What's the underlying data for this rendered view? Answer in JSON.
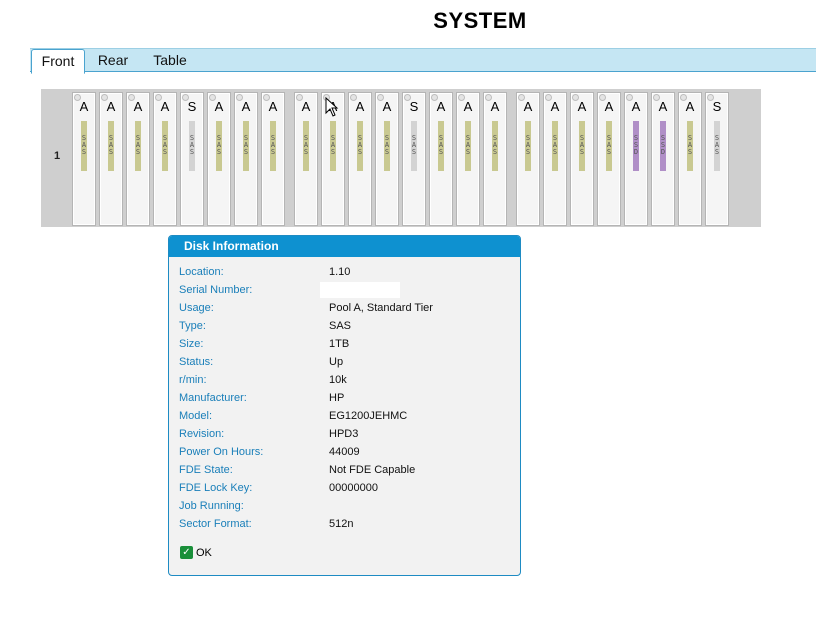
{
  "page": {
    "title": "SYSTEM"
  },
  "tabs": [
    {
      "label": "Front",
      "active": true
    },
    {
      "label": "Rear",
      "active": false
    },
    {
      "label": "Table",
      "active": false
    }
  ],
  "enclosure": {
    "row_label": "1",
    "disks": [
      {
        "letter": "A",
        "type": "SAS",
        "color": "#c9c991"
      },
      {
        "letter": "A",
        "type": "SAS",
        "color": "#c9c991"
      },
      {
        "letter": "A",
        "type": "SAS",
        "color": "#c9c991"
      },
      {
        "letter": "A",
        "type": "SAS",
        "color": "#c9c991"
      },
      {
        "letter": "S",
        "type": "SAS",
        "color": "#d3d3d3"
      },
      {
        "letter": "A",
        "type": "SAS",
        "color": "#c9c991"
      },
      {
        "letter": "A",
        "type": "SAS",
        "color": "#c9c991"
      },
      {
        "letter": "A",
        "type": "SAS",
        "color": "#c9c991"
      },
      {
        "letter": "A",
        "type": "SAS",
        "color": "#c9c991"
      },
      {
        "letter": "A",
        "type": "SAS",
        "color": "#c9c991"
      },
      {
        "letter": "A",
        "type": "SAS",
        "color": "#c9c991"
      },
      {
        "letter": "A",
        "type": "SAS",
        "color": "#c9c991"
      },
      {
        "letter": "S",
        "type": "SAS",
        "color": "#d3d3d3"
      },
      {
        "letter": "A",
        "type": "SAS",
        "color": "#c9c991"
      },
      {
        "letter": "A",
        "type": "SAS",
        "color": "#c9c991"
      },
      {
        "letter": "A",
        "type": "SAS",
        "color": "#c9c991"
      },
      {
        "letter": "A",
        "type": "SAS",
        "color": "#c9c991"
      },
      {
        "letter": "A",
        "type": "SAS",
        "color": "#c9c991"
      },
      {
        "letter": "A",
        "type": "SAS",
        "color": "#c9c991"
      },
      {
        "letter": "A",
        "type": "SAS",
        "color": "#c9c991"
      },
      {
        "letter": "A",
        "type": "SSD",
        "color": "#b08fc7"
      },
      {
        "letter": "A",
        "type": "SSD",
        "color": "#b08fc7"
      },
      {
        "letter": "A",
        "type": "SAS",
        "color": "#c9c991"
      },
      {
        "letter": "S",
        "type": "SAS",
        "color": "#d3d3d3"
      }
    ]
  },
  "disk_info": {
    "header": "Disk Information",
    "rows": [
      {
        "label": "Location:",
        "value": "1.10"
      },
      {
        "label": "Serial Number:",
        "value": ""
      },
      {
        "label": "Usage:",
        "value": "Pool A, Standard Tier"
      },
      {
        "label": "Type:",
        "value": "SAS"
      },
      {
        "label": "Size:",
        "value": "1TB"
      },
      {
        "label": "Status:",
        "value": "Up"
      },
      {
        "label": "r/min:",
        "value": "10k"
      },
      {
        "label": "Manufacturer:",
        "value": "HP"
      },
      {
        "label": "Model:",
        "value": "EG1200JEHMC"
      },
      {
        "label": "Revision:",
        "value": "HPD3"
      },
      {
        "label": "Power On Hours:",
        "value": "44009"
      },
      {
        "label": "FDE State:",
        "value": "Not FDE Capable"
      },
      {
        "label": "FDE Lock Key:",
        "value": "00000000"
      },
      {
        "label": "Job Running:",
        "value": ""
      },
      {
        "label": "Sector Format:",
        "value": "512n"
      }
    ],
    "ok_label": "OK"
  }
}
